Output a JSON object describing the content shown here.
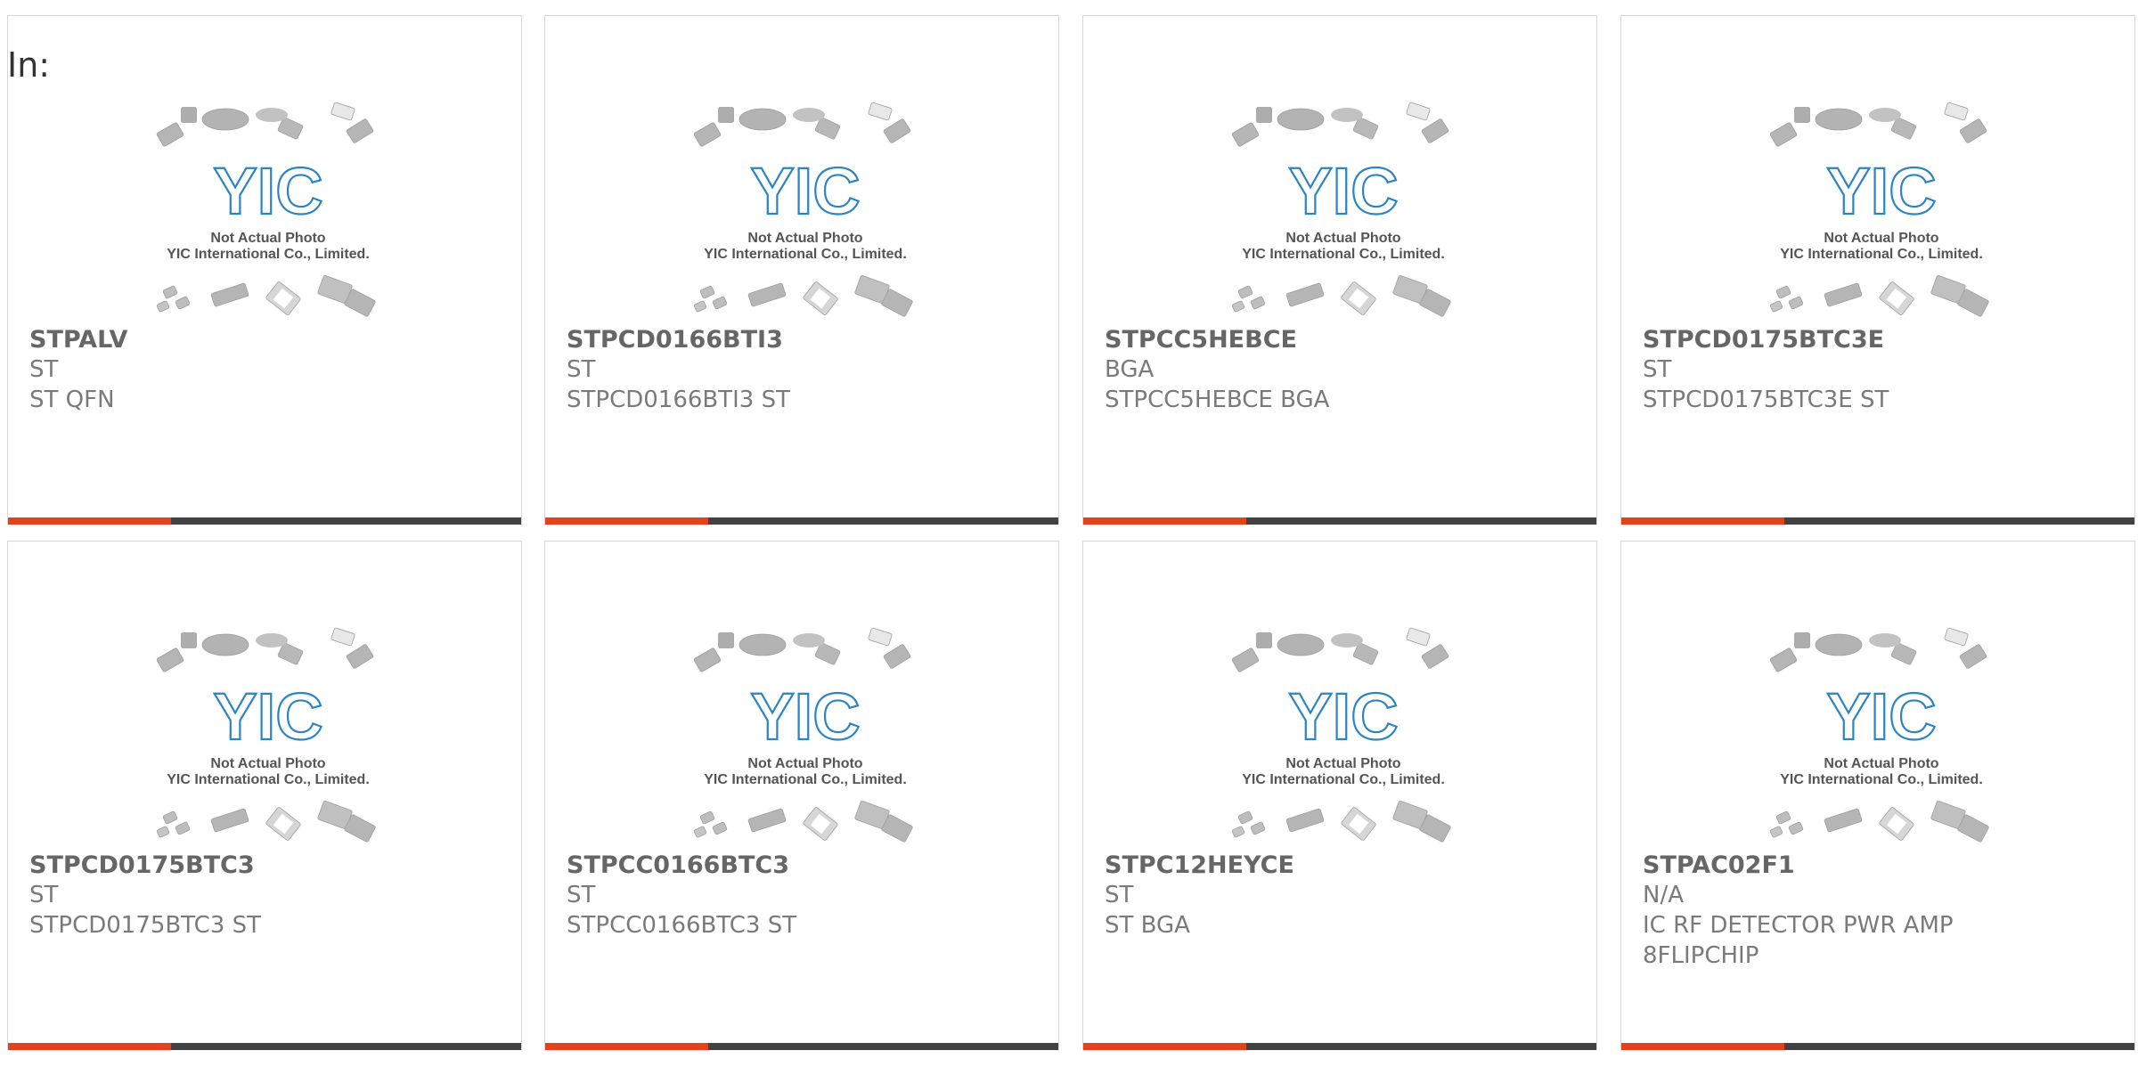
{
  "in_label": "In:",
  "placeholder_image": {
    "line1": "Not Actual Photo",
    "line2": "YIC International Co., Limited.",
    "logo": "YIC"
  },
  "colors": {
    "accent": "#e1431b",
    "bar": "#424242",
    "logo": "#2b84c4"
  },
  "products": [
    {
      "part": "STPALV",
      "mfr": "ST",
      "desc": "ST QFN"
    },
    {
      "part": "STPCD0166BTI3",
      "mfr": "ST",
      "desc": "STPCD0166BTI3 ST"
    },
    {
      "part": "STPCC5HEBCE",
      "mfr": "BGA",
      "desc": "STPCC5HEBCE BGA"
    },
    {
      "part": "STPCD0175BTC3E",
      "mfr": "ST",
      "desc": "STPCD0175BTC3E ST"
    },
    {
      "part": "STPCD0175BTC3",
      "mfr": "ST",
      "desc": "STPCD0175BTC3 ST"
    },
    {
      "part": "STPCC0166BTC3",
      "mfr": "ST",
      "desc": "STPCC0166BTC3 ST"
    },
    {
      "part": "STPC12HEYCE",
      "mfr": "ST",
      "desc": "ST BGA"
    },
    {
      "part": "STPAC02F1",
      "mfr": "N/A",
      "desc": "IC RF DETECTOR PWR AMP 8FLIPCHIP"
    }
  ]
}
